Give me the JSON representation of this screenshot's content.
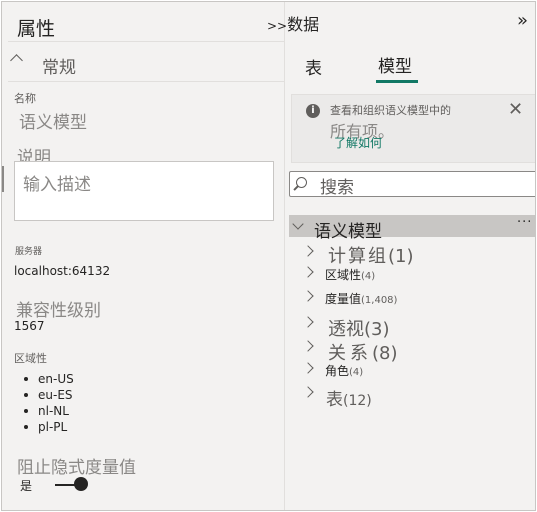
{
  "properties": {
    "title": "属性",
    "general_section": "常规",
    "name_label": "名称",
    "name_value": "语义模型",
    "description_label": "说明",
    "description_placeholder": "输入描述",
    "server_label": "服务器",
    "server_value": "localhost:64132",
    "compat_label": "兼容性级别",
    "compat_value": "1567",
    "cultures_label": "区域性",
    "cultures": [
      "en-US",
      "eu-ES",
      "nl-NL",
      "pl-PL"
    ],
    "discourage_label": "阻止隐式度量值",
    "discourage_value": "是",
    "discourage_on": true
  },
  "data_pane": {
    "expand_glyph": ">>",
    "title": "数据",
    "collapse_glyph": "»",
    "tabs": [
      "表",
      "模型"
    ],
    "active_tab": "模型",
    "info_text_line1": "查看和组织语义模型中的",
    "info_text_line2": "所有项。",
    "info_link": "了解如何",
    "search_placeholder": "搜索",
    "tree_root": "语义模型",
    "more_glyph": "···",
    "nodes": [
      {
        "label": "计算组",
        "count": "(1)"
      },
      {
        "label": "区域性",
        "count": "(4)"
      },
      {
        "label": "度量值",
        "count": "(1,408)"
      },
      {
        "label": "透视",
        "count": "(3)"
      },
      {
        "label": "关系",
        "count": "(8)"
      },
      {
        "label": "角色",
        "count": "(4)"
      },
      {
        "label": "表",
        "count": "(12)"
      }
    ]
  },
  "colors": {
    "accent": "#117865",
    "pane_bg": "#f3f2f1",
    "selected_row": "#c8c6c4"
  }
}
